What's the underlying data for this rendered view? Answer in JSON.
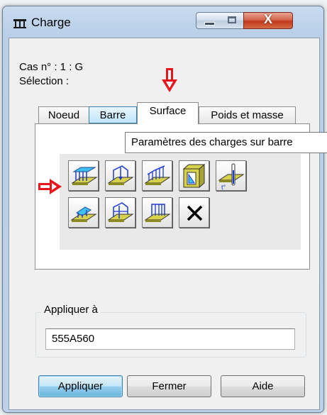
{
  "window": {
    "title": "Charge",
    "close_glyph": "X"
  },
  "info": {
    "case_line": "Cas n° : 1 : G",
    "selection_line": "Sélection :"
  },
  "tabs": [
    {
      "label": "Noeud"
    },
    {
      "label": "Barre"
    },
    {
      "label": "Surface"
    },
    {
      "label": "Poids et masse"
    }
  ],
  "active_tab": "Surface",
  "tooltip": "Paramètres des charges sur barre",
  "icon_buttons": [
    {
      "icon": "uniform-surface-load-icon"
    },
    {
      "icon": "point-load-on-surface-icon"
    },
    {
      "icon": "linear-load-on-surface-icon"
    },
    {
      "icon": "hydrostatic-pressure-icon"
    },
    {
      "icon": "thermal-load-icon"
    },
    {
      "icon": "surface-load-by-3-points-icon"
    },
    {
      "icon": "point-load-on-contour-icon"
    },
    {
      "icon": "linear-load-on-contour-icon"
    },
    {
      "icon": "delete-load-icon"
    }
  ],
  "apply_to": {
    "label": "Appliquer à",
    "value": "555A560"
  },
  "buttons": {
    "apply": "Appliquer",
    "close": "Fermer",
    "help": "Aide"
  },
  "colors": {
    "annotation_arrow": "#e8151b",
    "plate_yellow": "#d8d24a",
    "load_blue": "#3a6ff0"
  }
}
